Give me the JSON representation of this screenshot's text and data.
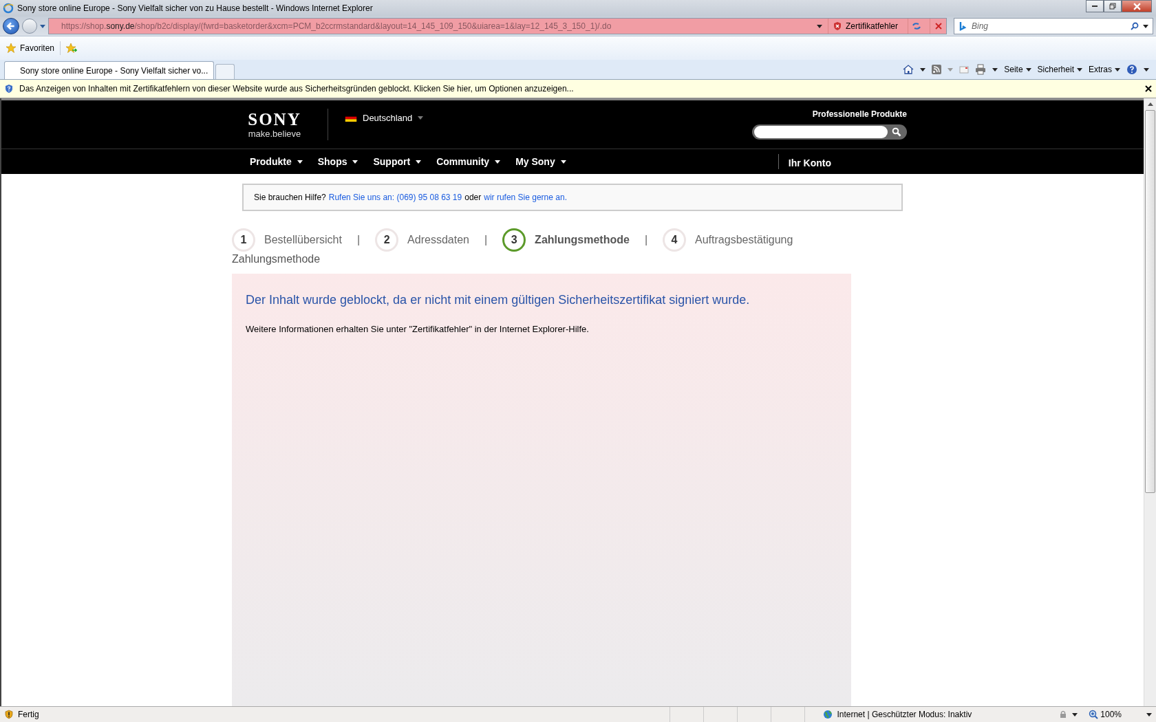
{
  "window": {
    "title": "Sony store online Europe - Sony Vielfalt sicher von zu Hause bestellt  - Windows Internet Explorer"
  },
  "address_bar": {
    "url": "https://shop.**sony.de**/shop/b2c/display/(fwrd=basketorder&xcm=PCM_b2ccrmstandard&layout=14_145_109_150&uiarea=1&lay=12_145_3_150_1)/.do",
    "certificate_error": "Zertifikatfehler"
  },
  "search": {
    "placeholder": "Bing"
  },
  "favorites_bar": {
    "label": "Favoriten"
  },
  "tabs": [
    {
      "label": "Sony store online Europe - Sony Vielfalt sicher vo...",
      "selected": true
    }
  ],
  "command_bar": [
    "Seite",
    "Sicherheit",
    "Extras"
  ],
  "info_bar": {
    "text": "Das Anzeigen von Inhalten mit Zertifikatfehlern von dieser Website wurde aus Sicherheitsgründen geblockt. Klicken Sie hier, um Optionen anzuzeigen..."
  },
  "site": {
    "logo": "SONY",
    "tagline": "make.believe",
    "country": "Deutschland",
    "pro_link": "Professionelle Produkte",
    "nav": [
      "Produkte",
      "Shops",
      "Support",
      "Community",
      "My Sony"
    ],
    "account": "Ihr Konto"
  },
  "help": {
    "prefix": "Sie brauchen Hilfe?",
    "phone_link": "Rufen Sie uns an: (069) 95 08 63 19",
    "middle": "oder",
    "callback_link": "wir rufen Sie gerne an."
  },
  "steps": [
    {
      "number": "1",
      "label": "Bestellübersicht",
      "selected": false,
      "separator": "|"
    },
    {
      "number": "2",
      "label": "Adressdaten",
      "selected": false,
      "separator": "|"
    },
    {
      "number": "3",
      "label": "Zahlungsmethode",
      "selected": true,
      "separator": "|"
    },
    {
      "number": "4",
      "label": "Auftragsbestätigung",
      "selected": false
    }
  ],
  "section_title": "Zahlungsmethode",
  "blocked": {
    "heading": "Der Inhalt wurde geblockt, da er nicht mit einem gültigen Sicherheitszertifikat signiert wurde.",
    "info": "Weitere Informationen erhalten Sie unter \"Zertifikatfehler\" in der Internet Explorer-Hilfe."
  },
  "status_bar": {
    "status": "Fertig",
    "zone": "Internet | Geschützter Modus: Inaktiv",
    "zoom": "100%"
  }
}
